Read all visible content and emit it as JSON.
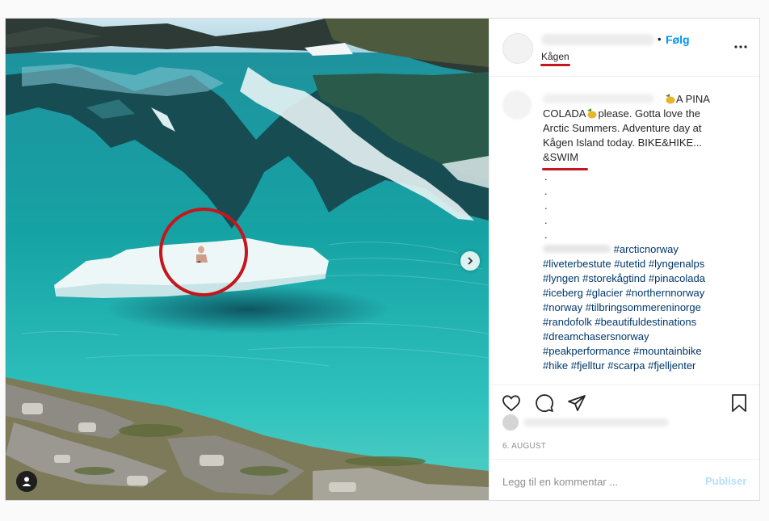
{
  "post": {
    "header": {
      "follow_dot": "•",
      "follow_label": "Følg",
      "location": "Kågen",
      "more_icon": "more-horizontal-icon"
    },
    "caption": {
      "line1": "A PINA",
      "line2_a": "COLADA",
      "line2_b": "please. Gotta love the",
      "line3": "Arctic Summers. Adventure day at",
      "line4": "Kågen Island today. BIKE&HIKE...",
      "line5": "&SWIM",
      "dots": [
        ".",
        ".",
        ".",
        ".",
        "."
      ],
      "emoji": "pineapple-icon"
    },
    "hashtags": [
      [
        "#arcticnorway"
      ],
      [
        "#liveterbestute",
        "#utetid",
        "#lyngenalps"
      ],
      [
        "#lyngen",
        "#storekågtind",
        "#pinacolada"
      ],
      [
        "#iceberg",
        "#glacier",
        "#northernnorway"
      ],
      [
        "#norway",
        "#tilbringsommereninorge"
      ],
      [
        "#randofolk",
        "#beautifuldestinations"
      ],
      [
        "#dreamchasersnorway"
      ],
      [
        "#peakperformance",
        "#mountainbike"
      ],
      [
        "#hike",
        "#fjelltur",
        "#scarpa",
        "#fjelljenter"
      ]
    ],
    "actions": {
      "like_icon": "heart-icon",
      "comment_icon": "comment-icon",
      "share_icon": "paper-plane-icon",
      "save_icon": "bookmark-icon"
    },
    "date": "6. AUGUST",
    "comment": {
      "placeholder": "Legg til en kommentar ...",
      "publish_label": "Publiser"
    },
    "annotation_color": "#c4161c",
    "link_color": "#0095f6",
    "hashtag_color": "#00376b"
  }
}
